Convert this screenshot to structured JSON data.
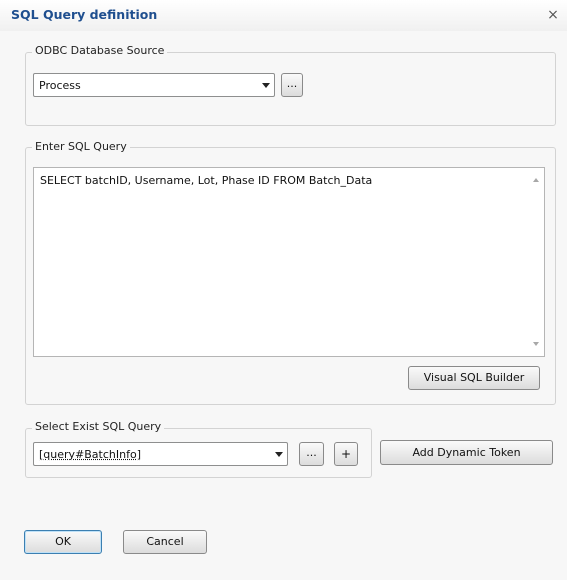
{
  "window": {
    "title": "SQL Query definition",
    "close_glyph": "×"
  },
  "odbc": {
    "legend": "ODBC Database Source",
    "selected": "Process",
    "browse_label": "..."
  },
  "query": {
    "legend": "Enter SQL Query",
    "text": "SELECT batchID, Username, Lot, Phase ID FROM Batch_Data",
    "builder_label": "Visual SQL Builder"
  },
  "existing": {
    "legend": "Select Exist SQL Query",
    "selected": "[query#BatchInfo]",
    "browse_label": "...",
    "add_label": "+",
    "token_label": "Add Dynamic Token"
  },
  "footer": {
    "ok_label": "OK",
    "cancel_label": "Cancel"
  }
}
